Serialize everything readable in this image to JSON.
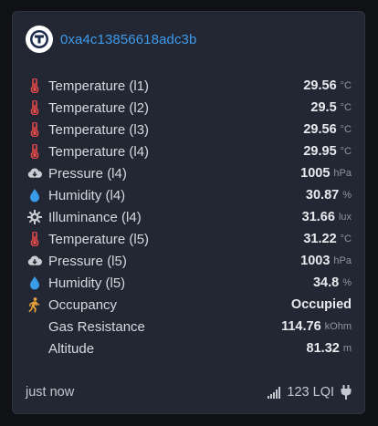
{
  "device": {
    "id": "0xa4c13856618adc3b",
    "avatar_icon": "device-logo-icon"
  },
  "readings": [
    {
      "label": "Temperature (l1)",
      "value": "29.56",
      "unit": "°C",
      "icon": "thermometer-icon"
    },
    {
      "label": "Temperature (l2)",
      "value": "29.5",
      "unit": "°C",
      "icon": "thermometer-icon"
    },
    {
      "label": "Temperature (l3)",
      "value": "29.56",
      "unit": "°C",
      "icon": "thermometer-icon"
    },
    {
      "label": "Temperature (l4)",
      "value": "29.95",
      "unit": "°C",
      "icon": "thermometer-icon"
    },
    {
      "label": "Pressure (l4)",
      "value": "1005",
      "unit": "hPa",
      "icon": "cloud-download-icon"
    },
    {
      "label": "Humidity (l4)",
      "value": "30.87",
      "unit": "%",
      "icon": "water-drop-icon"
    },
    {
      "label": "Illuminance (l4)",
      "value": "31.66",
      "unit": "lux",
      "icon": "sun-gear-icon"
    },
    {
      "label": "Temperature (l5)",
      "value": "31.22",
      "unit": "°C",
      "icon": "thermometer-icon"
    },
    {
      "label": "Pressure (l5)",
      "value": "1003",
      "unit": "hPa",
      "icon": "cloud-download-icon"
    },
    {
      "label": "Humidity (l5)",
      "value": "34.8",
      "unit": "%",
      "icon": "water-drop-icon"
    },
    {
      "label": "Occupancy",
      "value": "Occupied",
      "unit": "",
      "icon": "walking-person-icon"
    },
    {
      "label": "Gas Resistance",
      "value": "114.76",
      "unit": "kOhm",
      "icon": ""
    },
    {
      "label": "Altitude",
      "value": "81.32",
      "unit": "m",
      "icon": ""
    }
  ],
  "footer": {
    "last_seen": "just now",
    "lqi": "123 LQI",
    "signal_icon": "signal-bars-icon",
    "power_icon": "plug-icon"
  },
  "colors": {
    "card_bg": "#222733",
    "link": "#3f9bea",
    "thermometer": "#e04848",
    "humidity": "#3a9be8",
    "occupancy": "#e9a23b",
    "neutral_icon": "#c9ccd2"
  }
}
